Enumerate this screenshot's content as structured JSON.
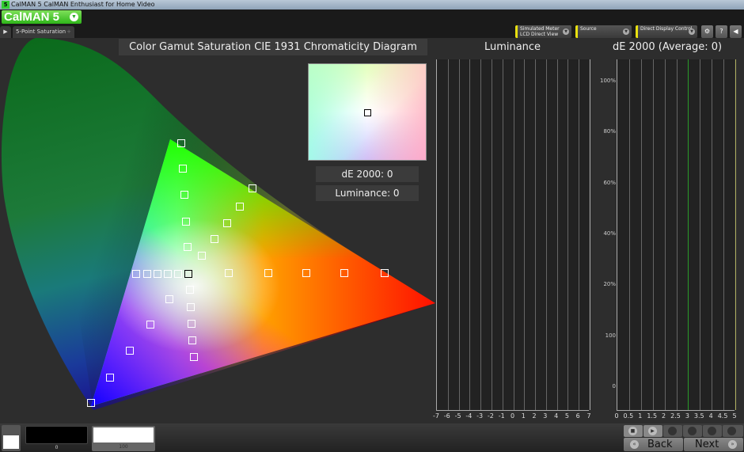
{
  "window": {
    "title": "CalMAN 5 CalMAN Enthusiast for Home Video",
    "app_icon": "5"
  },
  "logo": {
    "text": "CalMAN 5",
    "brand_color": "#3cc22a"
  },
  "tabs": [
    {
      "label": "5-Point Saturation",
      "active": true
    }
  ],
  "toolbar": {
    "meter": {
      "line1": "Simulated Meter",
      "line2": "LCD Direct View"
    },
    "source": {
      "line1": "Source"
    },
    "display": {
      "line1": "Direct Display Control"
    },
    "icons": [
      "gear-icon",
      "help-icon",
      "collapse-icon"
    ]
  },
  "cie": {
    "title": "Color Gamut Saturation CIE 1931 Chromaticity Diagram",
    "de_label": "dE 2000: 0",
    "luminance_label": "Luminance: 0"
  },
  "luminance_chart": {
    "title": "Luminance",
    "x_ticks": [
      "-7",
      "-6",
      "-5",
      "-4",
      "-3",
      "-2",
      "-1",
      "0",
      "1",
      "2",
      "3",
      "4",
      "5",
      "6",
      "7"
    ]
  },
  "de_chart": {
    "title": "dE 2000 (Average: 0)",
    "x_ticks": [
      "0",
      "0.5",
      "1",
      "1.5",
      "2",
      "2.5",
      "3",
      "3.5",
      "4",
      "4.5",
      "5"
    ],
    "y_ticks": [
      "100%",
      "80%",
      "60%",
      "40%",
      "20%",
      "100",
      "0"
    ],
    "threshold_color": "#2a9a2a",
    "limit_color": "#b0b060"
  },
  "bottom": {
    "swatch_black_label": "0",
    "swatch_white_label": "100",
    "back": "Back",
    "next": "Next"
  }
}
